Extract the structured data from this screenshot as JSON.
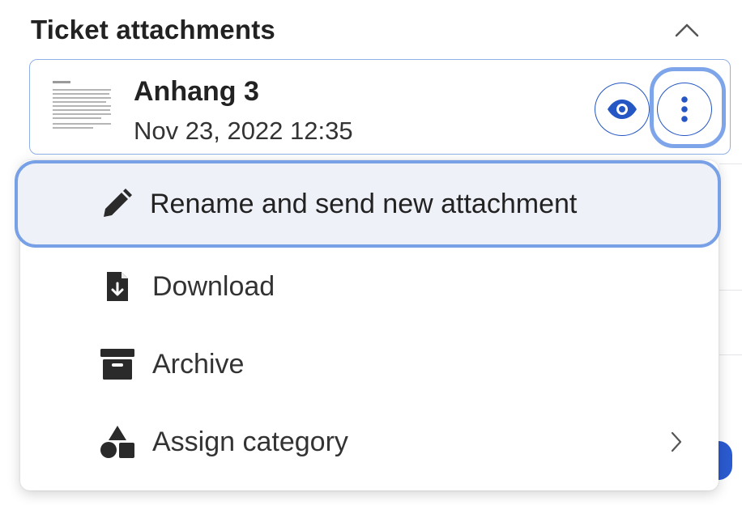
{
  "section": {
    "title": "Ticket attachments",
    "collapse_icon": "chevron-up-icon"
  },
  "attachment": {
    "name": "Anhang 3",
    "date": "Nov 23, 2022 12:35",
    "thumbnail_icon": "document-thumbnail",
    "preview_icon": "eye-icon",
    "more_icon": "vertical-dots-icon"
  },
  "menu": {
    "items": [
      {
        "label": "Rename and send new attachment",
        "icon": "pencil-icon"
      },
      {
        "label": "Download",
        "icon": "file-download-icon"
      },
      {
        "label": "Archive",
        "icon": "archive-box-icon"
      },
      {
        "label": "Assign category",
        "icon": "shapes-icon"
      }
    ]
  },
  "colors": {
    "accent": "#2456c4",
    "focus_ring": "#78a0e6",
    "active_bg": "#eef1f8"
  }
}
